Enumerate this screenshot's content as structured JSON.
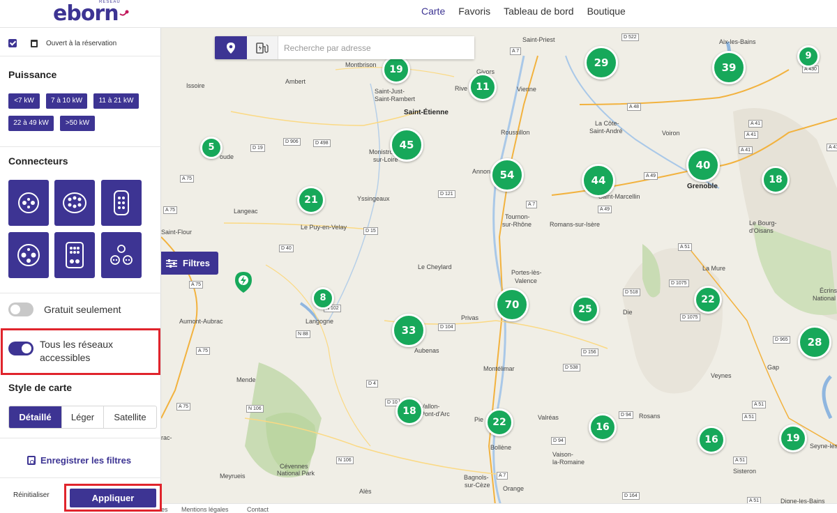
{
  "brand": {
    "reseau": "RÉSEAU",
    "name": "eborn"
  },
  "nav": {
    "items": [
      "Carte",
      "Favoris",
      "Tableau de bord",
      "Boutique"
    ],
    "active": "Carte"
  },
  "sidebar": {
    "reservation_label": "Ouvert à la réservation",
    "puissance": {
      "title": "Puissance",
      "options": [
        "<7 kW",
        "7 à 10 kW",
        "11 à 21 kW",
        "22 à 49 kW",
        ">50 kW"
      ]
    },
    "connecteurs": {
      "title": "Connecteurs",
      "icons": [
        "type2-socket-icon",
        "combo-ccs-icon",
        "chademo-icon",
        "type3-socket-icon",
        "ccs-combo2-icon",
        "domestic-socket-icon"
      ]
    },
    "gratuit_label": "Gratuit seulement",
    "gratuit_on": false,
    "reseaux_label_1": "Tous les réseaux",
    "reseaux_label_2": "accessibles",
    "reseaux_on": true,
    "style": {
      "title": "Style de carte",
      "options": [
        "Détaillé",
        "Léger",
        "Satellite"
      ],
      "selected": "Détaillé"
    },
    "save_label": "Enregistrer les filtres",
    "reset_label": "Réinitialiser",
    "apply_label": "Appliquer"
  },
  "map": {
    "search_placeholder": "Recherche par adresse",
    "filtres_label": "Filtres",
    "clusters": [
      "19",
      "11",
      "29",
      "39",
      "9",
      "5",
      "45",
      "54",
      "44",
      "40",
      "18",
      "21",
      "8",
      "70",
      "25",
      "22",
      "33",
      "28",
      "18",
      "22",
      "16",
      "16",
      "19"
    ],
    "places": {
      "montbrison": "Montbrison",
      "saint_just": "Saint-Just-",
      "saint_rambert": "Saint-Rambert",
      "saint_etienne": "Saint-Étienne",
      "givors": "Givors",
      "vienne": "Vienne",
      "rive": "Rive",
      "saint_priest": "Saint-Priest",
      "aix": "Aix-les-Bains",
      "issoire": "Issoire",
      "ambert": "Ambert",
      "monistrol": "Monistrol-",
      "sur_loire": "sur-Loire",
      "roussillon": "Roussillon",
      "annonay": "Annon",
      "la_cote": "La Côte-",
      "saint_andre": "Saint-André",
      "voiron": "Voiron",
      "grenoble": "Grenoble",
      "saint_marcellin": "Saint-Marcellin",
      "yssingeaux": "Yssingeaux",
      "langeac": "Langeac",
      "le_puy": "Le Puy-en-Velay",
      "tournon": "Tournon-",
      "sur_rhone": "sur-Rhône",
      "romans": "Romans-sur-Isère",
      "saint_flour": "Saint-Flour",
      "le_cheylard": "Le Cheylard",
      "portes": "Portes-lès-",
      "valence": "Valence",
      "la_mure": "La Mure",
      "le_bourg": "Le Bourg-",
      "oisans": "d'Oisans",
      "ecrins": "Écrins",
      "national_park": "National Park",
      "aumont": "Aumont-Aubrac",
      "langogne": "Langogne",
      "privas": "Privas",
      "die": "Die",
      "aubenas": "Aubenas",
      "montelimar": "Montélimar",
      "veynes": "Veynes",
      "gap": "Gap",
      "mende": "Mende",
      "vallon": "Vallon-",
      "pont_arc": "Pont-d'Arc",
      "pierrelatte": "Pie",
      "valreas": "Valréas",
      "rosans": "Rosans",
      "bollene": "Bollène",
      "vaison": "Vaison-",
      "la_romaine": "la-Romaine",
      "seyne": "Seyne-les-",
      "cevennes": "Cévennes",
      "cevennes_np": "National Park",
      "meyrueis": "Meyrueis",
      "sisteron": "Sisteron",
      "bagnols": "Bagnols-",
      "sur_ceze": "sur-Cèze",
      "orange": "Orange",
      "ales": "Alès",
      "digne": "Digne-les-Bains",
      "roude": "oude",
      "riac": "rac-"
    },
    "roads": [
      "D 522",
      "A 7",
      "A 430",
      "A 48",
      "A 41",
      "A 41",
      "A 41",
      "A 41",
      "D 906",
      "D 498",
      "D 19",
      "A 75",
      "D 121",
      "A 49",
      "A 49",
      "A 7",
      "D 15",
      "D 40",
      "A 75",
      "A 75",
      "A 51",
      "D 1075",
      "D 518",
      "N 102",
      "D 104",
      "D 1075",
      "N 88",
      "A 75",
      "D 156",
      "D 538",
      "D 965",
      "D 4",
      "D 94",
      "D 94",
      "D 10",
      "A 51",
      "A 51",
      "A 75",
      "N 106",
      "N 106",
      "D 94",
      "A 7",
      "A 51",
      "D 164",
      "A 51",
      "A 75",
      "A 51"
    ]
  },
  "footer": {
    "items": [
      "es",
      "Mentions légales",
      "Contact"
    ]
  },
  "colors": {
    "brand": "#3d3493",
    "cluster": "#17a85a",
    "highlight": "#e0242c",
    "pin": "#17a85a"
  }
}
